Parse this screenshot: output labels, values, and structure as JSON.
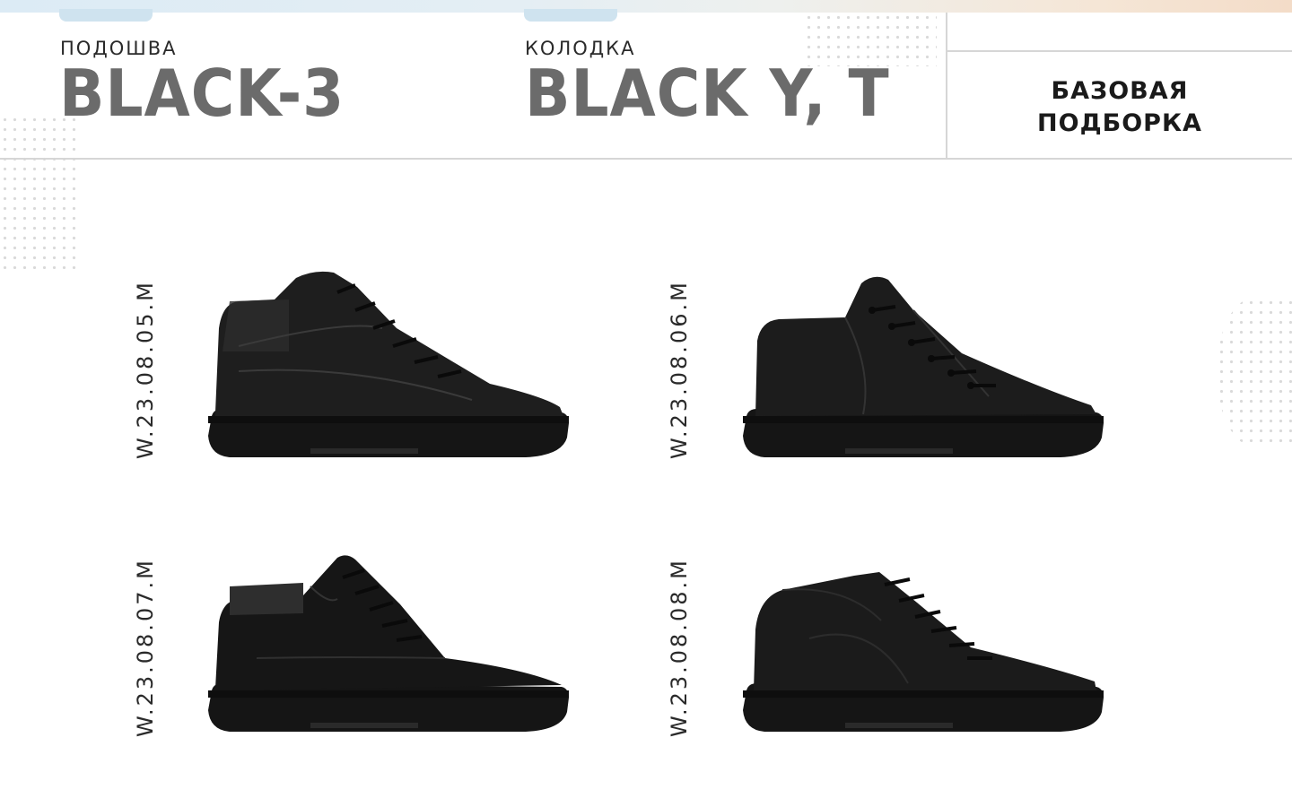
{
  "header": {
    "sole_caption": "ПОДОШВА",
    "sole_value": "BLACK-3",
    "last_caption": "КОЛОДКА",
    "last_value": "BLACK Y, T",
    "collection_line1": "БАЗОВАЯ",
    "collection_line2": "ПОДБОРКА"
  },
  "products": [
    {
      "sku": "W.23.08.05.M",
      "image": "high-top-leather-sneaker"
    },
    {
      "sku": "W.23.08.06.M",
      "image": "mid-top-leather-sneaker"
    },
    {
      "sku": "W.23.08.07.M",
      "image": "suede-chukka-boot"
    },
    {
      "sku": "W.23.08.08.M",
      "image": "mid-top-grain-leather-sneaker"
    }
  ],
  "colors": {
    "accent_gray": "#6b6b6b",
    "shoe_black": "#141414",
    "divider": "#d6d6d6"
  }
}
